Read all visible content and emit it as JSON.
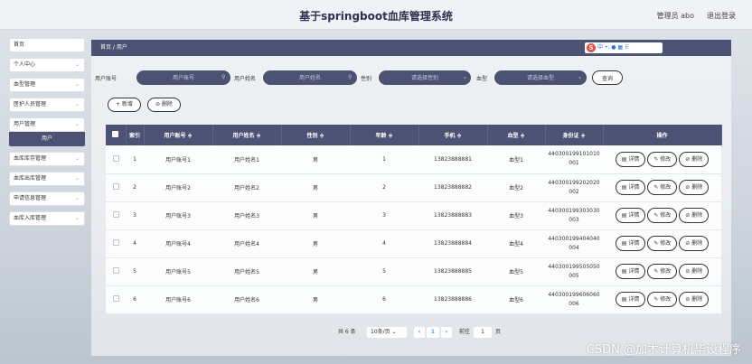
{
  "header": {
    "title": "基于springboot血库管理系统",
    "admin": "管理员 abo",
    "logout": "退出登录"
  },
  "sidebar": {
    "items": [
      {
        "label": "首页",
        "chevron": false
      },
      {
        "label": "个人中心",
        "chevron": true
      },
      {
        "label": "血型管理",
        "chevron": true
      },
      {
        "label": "医护人员管理",
        "chevron": true
      },
      {
        "label": "用户管理",
        "chevron": true,
        "sub": "用户"
      },
      {
        "label": "血库库存管理",
        "chevron": true
      },
      {
        "label": "血库出库管理",
        "chevron": true
      },
      {
        "label": "申请信息管理",
        "chevron": true
      },
      {
        "label": "血库入库管理",
        "chevron": true
      }
    ]
  },
  "breadcrumb": "首页 / 用户",
  "ime": "中 •, ● ▦ ⠿",
  "search": {
    "account_label": "用户账号",
    "account_placeholder": "用户账号",
    "name_label": "用户姓名",
    "name_placeholder": "用户姓名",
    "gender_label": "性别",
    "gender_placeholder": "请选择性别",
    "blood_label": "血型",
    "blood_placeholder": "请选择血型",
    "button": "查询"
  },
  "actions": {
    "add": "+ 新增",
    "delete": "⊘ 删除"
  },
  "table": {
    "columns": [
      "索引",
      "用户账号 ≑",
      "用户姓名 ≑",
      "性别 ≑",
      "年龄 ≑",
      "手机 ≑",
      "血型 ≑",
      "身份证 ≑",
      "操作"
    ],
    "rows": [
      {
        "index": "1",
        "account": "用户账号1",
        "name": "用户姓名1",
        "gender": "男",
        "age": "1",
        "phone": "13823888881",
        "blood": "血型1",
        "id_a": "440300199101010",
        "id_b": "001"
      },
      {
        "index": "2",
        "account": "用户账号2",
        "name": "用户姓名2",
        "gender": "男",
        "age": "2",
        "phone": "13823888882",
        "blood": "血型2",
        "id_a": "440300199202020",
        "id_b": "002"
      },
      {
        "index": "3",
        "account": "用户账号3",
        "name": "用户姓名3",
        "gender": "男",
        "age": "3",
        "phone": "13823888883",
        "blood": "血型3",
        "id_a": "440300199303030",
        "id_b": "003"
      },
      {
        "index": "4",
        "account": "用户账号4",
        "name": "用户姓名4",
        "gender": "男",
        "age": "4",
        "phone": "13823888884",
        "blood": "血型4",
        "id_a": "440300199404040",
        "id_b": "004"
      },
      {
        "index": "5",
        "account": "用户账号5",
        "name": "用户姓名5",
        "gender": "男",
        "age": "5",
        "phone": "13823888885",
        "blood": "血型5",
        "id_a": "440300199505050",
        "id_b": "005"
      },
      {
        "index": "6",
        "account": "用户账号6",
        "name": "用户姓名6",
        "gender": "男",
        "age": "6",
        "phone": "13823888886",
        "blood": "血型6",
        "id_a": "440300199606060",
        "id_b": "006"
      }
    ],
    "ops": {
      "detail": "▤ 详情",
      "edit": "✎ 修改",
      "delete": "⊘ 删除"
    }
  },
  "pagination": {
    "total": "共 6 条",
    "page_size": "10条/页 ⌄",
    "prev": "‹",
    "current": "1",
    "next": "›",
    "goto_label": "前往",
    "goto_value": "1",
    "page_suffix": "页"
  },
  "watermark": "CSDN @加木计算机毕设程序"
}
